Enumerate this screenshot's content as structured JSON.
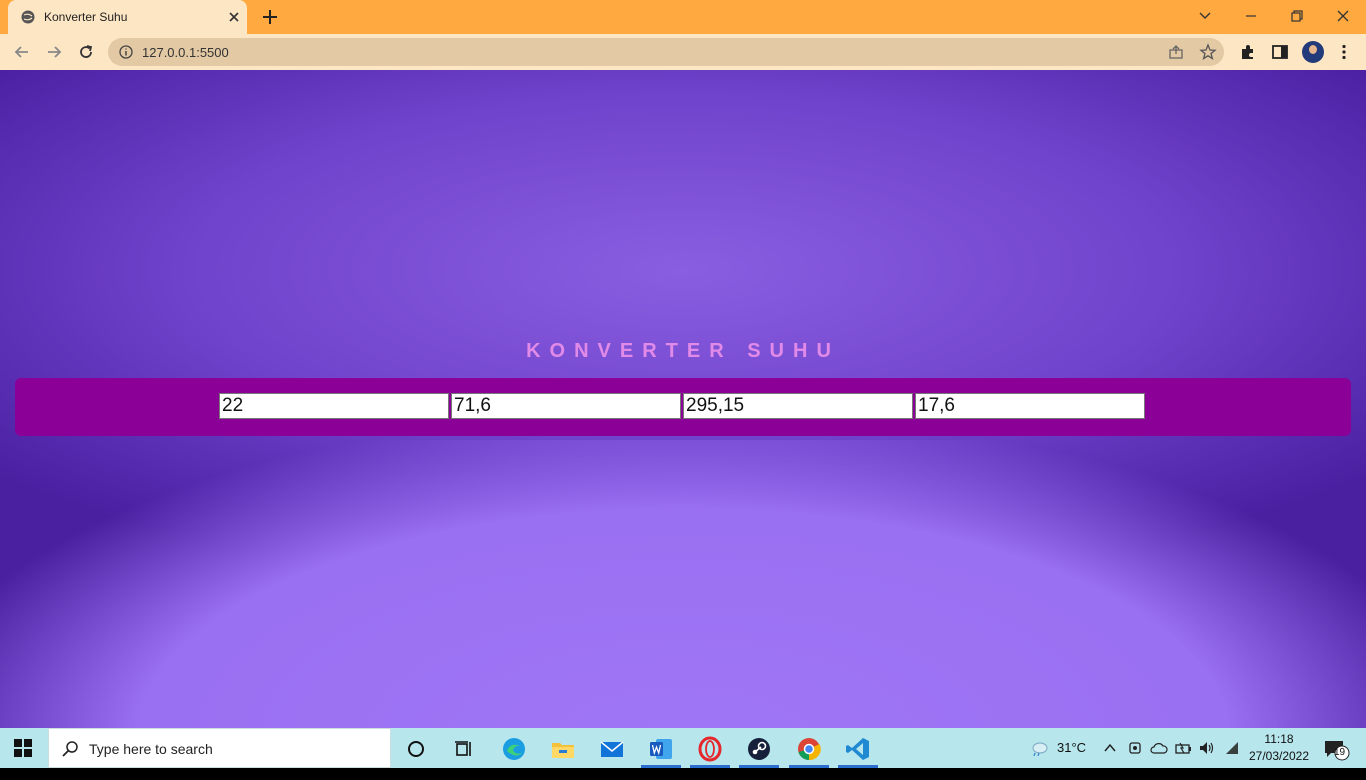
{
  "browser": {
    "tab_title": "Konverter Suhu",
    "url": "127.0.0.1:5500"
  },
  "page": {
    "heading": "KONVERTER SUHU",
    "fields": [
      {
        "value": "22"
      },
      {
        "value": "71,6"
      },
      {
        "value": "295,15"
      },
      {
        "value": "17,6"
      }
    ]
  },
  "taskbar": {
    "search_placeholder": "Type here to search",
    "weather": "31°C",
    "time": "11:18",
    "date": "27/03/2022",
    "notification_count": "19"
  },
  "colors": {
    "tabbar": "#ffa940",
    "panel": "#8b0097",
    "heading": "#e28ae8",
    "taskbar": "#b7e6ec"
  }
}
